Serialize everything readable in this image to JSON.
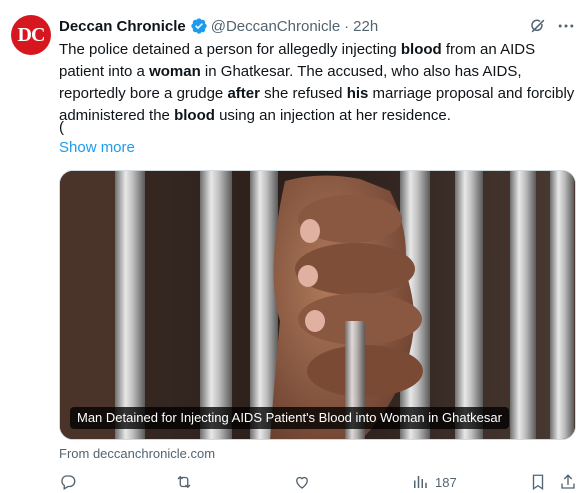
{
  "author": {
    "avatar_text": "DC",
    "name": "Deccan Chronicle",
    "handle": "@DeccanChronicle",
    "separator": "·",
    "time": "22h"
  },
  "tweet": {
    "segments": [
      {
        "text": "The police detained a person for allegedly injecting ",
        "bold": false
      },
      {
        "text": "blood",
        "bold": true
      },
      {
        "text": " from an AIDS patient into a ",
        "bold": false
      },
      {
        "text": "woman",
        "bold": true
      },
      {
        "text": " in Ghatkesar. The accused, who also has AIDS, reportedly bore a grudge ",
        "bold": false
      },
      {
        "text": "after",
        "bold": true
      },
      {
        "text": " she refused ",
        "bold": false
      },
      {
        "text": "his",
        "bold": true
      },
      {
        "text": " marriage proposal and forcibly administered the ",
        "bold": false
      },
      {
        "text": "blood",
        "bold": true
      },
      {
        "text": " using an injection at her residence.",
        "bold": false
      }
    ],
    "trailing": "(",
    "show_more": "Show more"
  },
  "card": {
    "caption": "Man Detained for Injecting AIDS Patient's Blood into Woman in Ghatkesar",
    "source": "From deccanchronicle.com"
  },
  "actions": {
    "reply_icon": "reply-icon",
    "retweet_icon": "retweet-icon",
    "like_icon": "like-icon",
    "views_icon": "views-icon",
    "views_count": "187",
    "bookmark_icon": "bookmark-icon",
    "share_icon": "share-icon"
  },
  "colors": {
    "brand_red": "#d7171f",
    "link_blue": "#1d9bf0",
    "muted_gray": "#536471",
    "text": "#0f1419"
  }
}
